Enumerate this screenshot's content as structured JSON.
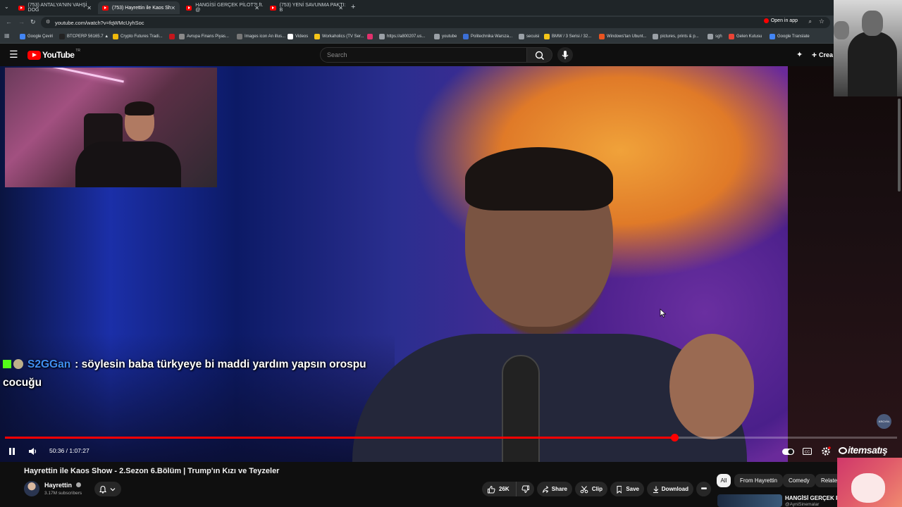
{
  "browser": {
    "tabs": [
      {
        "label": "(753) ANTALYA'NIN VAHŞİ DOĞ",
        "active": false
      },
      {
        "label": "(753) Hayrettin ile Kaos Sh",
        "active": true
      },
      {
        "label": "HANGİSİ GERÇEK PİLOT?! ft. @",
        "active": false
      },
      {
        "label": "(753) YENİ SAVUNMA PAKTI: B",
        "active": false
      }
    ],
    "url": "youtube.com/watch?v=fqWMcUyhSoc",
    "open_in_app": "Open in app",
    "bookmarks": [
      {
        "label": "Google Çeviri",
        "color": "#4285f4"
      },
      {
        "label": "BTCPERP 56165.7 ▲",
        "color": "#222222"
      },
      {
        "label": "Crypto Futures Tradi...",
        "color": "#f0b90b"
      },
      {
        "label": "",
        "color": "#c4161c"
      },
      {
        "label": "Avrupa Finans Piyas...",
        "color": "#8a8a8a"
      },
      {
        "label": "Images icon An illus...",
        "color": "#777777"
      },
      {
        "label": "Videos",
        "color": "#ffffff"
      },
      {
        "label": "Workaholics (TV Ser...",
        "color": "#f5c518"
      },
      {
        "label": "https://a800207.us...",
        "color": "#9aa0a6"
      },
      {
        "label": "",
        "color": "#e1306c"
      },
      {
        "label": "youtube",
        "color": "#9aa0a6"
      },
      {
        "label": "Politechnika Warsza...",
        "color": "#3b6fd6"
      },
      {
        "label": "secuisi",
        "color": "#9aa0a6"
      },
      {
        "label": "BMW / 3 Serisi / 32...",
        "color": "#f5c518"
      },
      {
        "label": "Windows'tan Ubunt...",
        "color": "#e95420"
      },
      {
        "label": "pictures, prints & p...",
        "color": "#9aa0a6"
      },
      {
        "label": "sgh",
        "color": "#9aa0a6"
      },
      {
        "label": "Gelen Kutusu",
        "color": "#ea4335"
      },
      {
        "label": "Google Translate",
        "color": "#4285f4"
      }
    ]
  },
  "youtube": {
    "logo": "YouTube",
    "logo_country": "TR",
    "search_placeholder": "Search",
    "create_label": "Crea"
  },
  "video": {
    "chat_user": "S2GGan",
    "chat_message": ": söylesin baba türkyeye bi maddi yardım yapsın orospu cocuğu",
    "time_current": "50:36",
    "time_total": "1:07:27",
    "time_display": "50:36 / 1:07:27",
    "progress_fraction": 0.75,
    "watermark": "itemsatış",
    "side_badge": "KROYİN"
  },
  "info": {
    "title": "Hayrettin ile Kaos Show - 2.Sezon 6.Bölüm | Trump'ın Kızı ve Teyzeler",
    "channel": "Hayrettin",
    "subscribers": "3.17M subscribers",
    "likes": "26K",
    "share": "Share",
    "clip": "Clip",
    "save": "Save",
    "download": "Download"
  },
  "chips": [
    {
      "label": "All",
      "selected": true
    },
    {
      "label": "From Hayrettin",
      "selected": false
    },
    {
      "label": "Comedy",
      "selected": false
    },
    {
      "label": "Relate",
      "selected": false
    }
  ],
  "related": {
    "title": "HANGİSİ GERÇEK PİL",
    "channel": "@AyniSinemalar"
  },
  "colors": {
    "accent": "#ff0000",
    "background": "#0f0f0f",
    "chat_user": "#3f8ef0"
  }
}
